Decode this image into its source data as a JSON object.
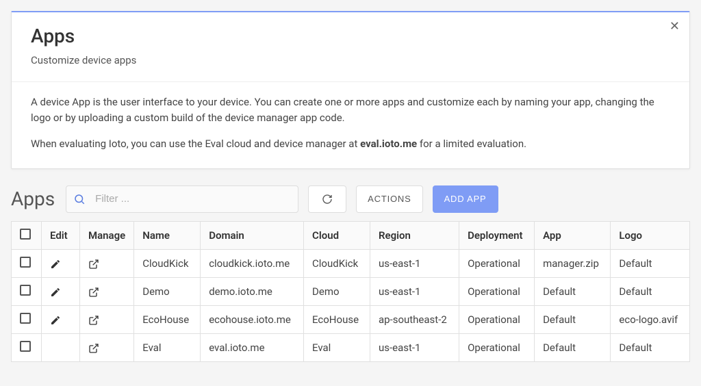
{
  "panel": {
    "title": "Apps",
    "subtitle": "Customize device apps",
    "para1": "A device App is the user interface to your device. You can create one or more apps and customize each by naming your app, changing the logo or by uploading a custom build of the device manager app code.",
    "para2_prefix": "When evaluating Ioto, you can use the Eval cloud and device manager at ",
    "para2_bold": "eval.ioto.me",
    "para2_suffix": " for a limited evaluation."
  },
  "toolbar": {
    "section": "Apps",
    "filter_placeholder": "Filter ...",
    "actions_label": "ACTIONS",
    "add_label": "ADD APP"
  },
  "table": {
    "headers": {
      "edit": "Edit",
      "manage": "Manage",
      "name": "Name",
      "domain": "Domain",
      "cloud": "Cloud",
      "region": "Region",
      "deployment": "Deployment",
      "app": "App",
      "logo": "Logo"
    },
    "rows": [
      {
        "editable": true,
        "name": "CloudKick",
        "domain": "cloudkick.ioto.me",
        "cloud": "CloudKick",
        "region": "us-east-1",
        "deployment": "Operational",
        "app": "manager.zip",
        "logo": "Default"
      },
      {
        "editable": true,
        "name": "Demo",
        "domain": "demo.ioto.me",
        "cloud": "Demo",
        "region": "us-east-1",
        "deployment": "Operational",
        "app": "Default",
        "logo": "Default"
      },
      {
        "editable": true,
        "name": "EcoHouse",
        "domain": "ecohouse.ioto.me",
        "cloud": "EcoHouse",
        "region": "ap-southeast-2",
        "deployment": "Operational",
        "app": "Default",
        "logo": "eco-logo.avif"
      },
      {
        "editable": false,
        "name": "Eval",
        "domain": "eval.ioto.me",
        "cloud": "Eval",
        "region": "us-east-1",
        "deployment": "Operational",
        "app": "Default",
        "logo": "Default"
      }
    ]
  }
}
